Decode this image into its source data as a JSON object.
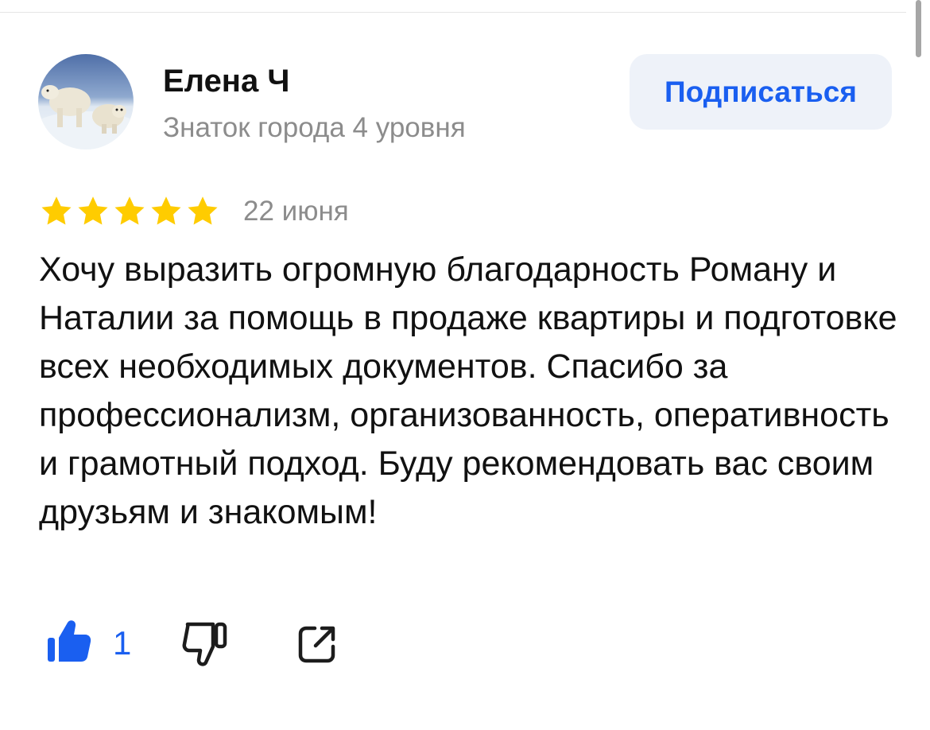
{
  "review": {
    "author": {
      "name": "Елена Ч",
      "level": "Знаток города 4 уровня"
    },
    "subscribe_label": "Подписаться",
    "rating": 5,
    "rating_max": 5,
    "date": "22 июня",
    "text": "Хочу выразить огромную благодарность Роману и Наталии за помощь в продаже квартиры и подготовке всех необходимых документов. Спасибо за профессионализм, организованность, оперативность и грамотный подход. Буду рекомендовать вас своим друзьям и знакомым!",
    "likes": "1"
  },
  "icons": {
    "avatar": "polar-bears-photo",
    "star": "star-icon",
    "like": "thumbs-up-icon",
    "dislike": "thumbs-down-icon",
    "share": "share-icon"
  },
  "colors": {
    "accent": "#1a5ff0",
    "star": "#ffcc00",
    "muted_text": "#8c8c8c",
    "button_bg": "#eef2f9"
  }
}
